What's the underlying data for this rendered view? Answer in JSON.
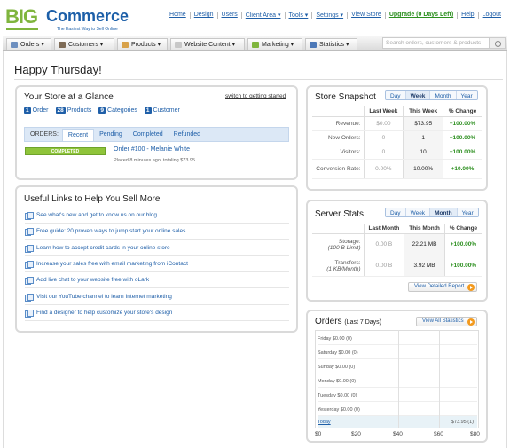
{
  "header": {
    "logo_big": "BIG",
    "logo_commerce": "Commerce",
    "logo_tagline": "The Easiest Way to Sell Online",
    "links": [
      "Home",
      "Design",
      "Users",
      "Client Area ▾",
      "Tools ▾",
      "Settings ▾",
      "View Store",
      "Upgrade (0 Days Left)",
      "Help",
      "Logout"
    ]
  },
  "nav": {
    "items": [
      "Orders ▾",
      "Customers ▾",
      "Products ▾",
      "Website Content ▾",
      "Marketing ▾",
      "Statistics ▾"
    ],
    "search_placeholder": "Search orders, customers & products"
  },
  "page": {
    "greeting": "Happy Thursday!"
  },
  "glance": {
    "title": "Your Store at a Glance",
    "switch_link": "switch to getting started",
    "counts": [
      {
        "n": "1",
        "label": "Order"
      },
      {
        "n": "28",
        "label": "Products"
      },
      {
        "n": "9",
        "label": "Categories"
      },
      {
        "n": "1",
        "label": "Customer"
      }
    ],
    "orders_label": "ORDERS:",
    "tabs": [
      "Recent",
      "Pending",
      "Completed",
      "Refunded"
    ],
    "order": {
      "status": "COMPLETED",
      "title": "Order #100 - Melanie White",
      "sub": "Placed 8 minutes ago, totaling $73.95"
    }
  },
  "links": {
    "title": "Useful Links to Help You Sell More",
    "items": [
      "See what's new and get to know us on our blog",
      "Free guide: 20 proven ways to jump start your online sales",
      "Learn how to accept credit cards in your online store",
      "Increase your sales free with email marketing from iContact",
      "Add live chat to your website free with oLark",
      "Visit our YouTube channel to learn Internet marketing",
      "Find a designer to help customize your store's design"
    ]
  },
  "snapshot": {
    "title": "Store Snapshot",
    "periods": [
      "Day",
      "Week",
      "Month",
      "Year"
    ],
    "active": "Week",
    "cols": [
      "Last Week",
      "This Week",
      "% Change"
    ],
    "rows": [
      {
        "label": "Revenue:",
        "a": "$0.00",
        "b": "$73.95",
        "c": "+100.00%"
      },
      {
        "label": "New Orders:",
        "a": "0",
        "b": "1",
        "c": "+100.00%"
      },
      {
        "label": "Visitors:",
        "a": "0",
        "b": "10",
        "c": "+100.00%"
      },
      {
        "label": "Conversion Rate:",
        "a": "0.00%",
        "b": "10.00%",
        "c": "+10.00%"
      }
    ]
  },
  "server": {
    "title": "Server Stats",
    "periods": [
      "Day",
      "Week",
      "Month",
      "Year"
    ],
    "active": "Month",
    "cols": [
      "Last Month",
      "This Month",
      "% Change"
    ],
    "rows": [
      {
        "label": "Storage:",
        "sub": "(100 B Limit)",
        "a": "0.00 B",
        "b": "22.21 MB",
        "c": "+100.00%"
      },
      {
        "label": "Transfers:",
        "sub": "(1 KB/Month)",
        "a": "0.00 B",
        "b": "3.92 MB",
        "c": "+100.00%"
      }
    ],
    "report_btn": "View Detailed Report"
  },
  "orders7": {
    "title": "Orders",
    "title_sub": "(Last 7 Days)",
    "all_btn": "View All Statistics",
    "rows": [
      {
        "day": "Friday $0.00 (0)",
        "val": ""
      },
      {
        "day": "Saturday $0.00 (0)",
        "val": ""
      },
      {
        "day": "Sunday $0.00 (0)",
        "val": ""
      },
      {
        "day": "Monday $0.00 (0)",
        "val": ""
      },
      {
        "day": "Tuesday $0.00 (0)",
        "val": ""
      },
      {
        "day": "Yesterday $0.00 (0)",
        "val": ""
      },
      {
        "day": "Today",
        "val": "$73.95 (1)"
      }
    ],
    "ticks": [
      "$0",
      "$20",
      "$40",
      "$60",
      "$80"
    ]
  },
  "chart_data": {
    "type": "bar",
    "categories": [
      "Friday",
      "Saturday",
      "Sunday",
      "Monday",
      "Tuesday",
      "Yesterday",
      "Today"
    ],
    "values": [
      0,
      0,
      0,
      0,
      0,
      0,
      73.95
    ],
    "xlim": [
      0,
      80
    ],
    "ticks": [
      "$0",
      "$20",
      "$40",
      "$60",
      "$80"
    ]
  }
}
